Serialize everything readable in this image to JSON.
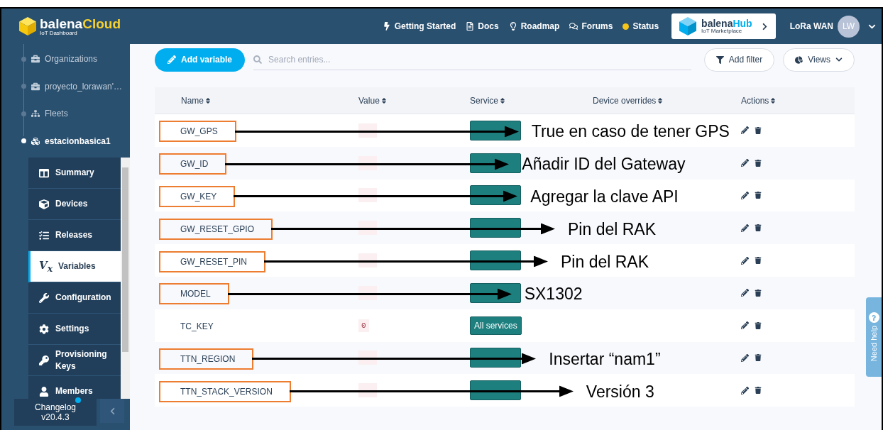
{
  "brand": {
    "name": "balena",
    "product": "Cloud",
    "subtitle": "IoT Dashboard"
  },
  "top_links": [
    {
      "label": "Getting Started"
    },
    {
      "label": "Docs"
    },
    {
      "label": "Roadmap"
    },
    {
      "label": "Forums"
    },
    {
      "label": "Status",
      "color": "#f5c518"
    }
  ],
  "hub": {
    "name": "balena",
    "product": "Hub",
    "subtitle": "IoT Marketplace"
  },
  "user": {
    "name": "LoRa WAN",
    "initials": "LW"
  },
  "breadcrumbs": [
    {
      "label": "Organizations",
      "selected": false
    },
    {
      "label": "proyecto_lorawan'…",
      "selected": false
    },
    {
      "label": "Fleets",
      "selected": false
    },
    {
      "label": "estacionbasica1",
      "selected": true
    }
  ],
  "nav": [
    {
      "label": "Summary",
      "selected": false
    },
    {
      "label": "Devices",
      "selected": false
    },
    {
      "label": "Releases",
      "selected": false
    },
    {
      "label": "Variables",
      "selected": true,
      "glyph": "V$_{x}$"
    },
    {
      "label": "Configuration",
      "selected": false
    },
    {
      "label": "Settings",
      "selected": false
    },
    {
      "label": "Provisioning Keys",
      "selected": false
    },
    {
      "label": "Members",
      "selected": false
    }
  ],
  "changelog": {
    "label": "Changelog",
    "version": "v20.4.3"
  },
  "toolbar": {
    "add_button": "Add variable",
    "search": {
      "placeholder": "Search entries..."
    },
    "filter_button": "Add filter",
    "views_button": "Views"
  },
  "table": {
    "columns": [
      "Name",
      "Value",
      "Service",
      "Device overrides",
      "Actions"
    ],
    "rows": [
      {
        "name": "GW_GPS",
        "highlighted": true,
        "note": "True en caso de tener GPS"
      },
      {
        "name": "GW_ID",
        "highlighted": true,
        "note": "Añadir ID del Gateway"
      },
      {
        "name": "GW_KEY",
        "highlighted": true,
        "note": "Agregar la clave API"
      },
      {
        "name": "GW_RESET_GPIO",
        "highlighted": true,
        "note": "Pin del RAK"
      },
      {
        "name": "GW_RESET_PIN",
        "highlighted": true,
        "note": "Pin del RAK"
      },
      {
        "name": "MODEL",
        "highlighted": true,
        "note": "SX1302"
      },
      {
        "name": "TC_KEY",
        "value": "0",
        "service": "All services",
        "highlighted": false
      },
      {
        "name": "TTN_REGION",
        "highlighted": true,
        "note": "Insertar “nam1”"
      },
      {
        "name": "TTN_STACK_VERSION",
        "highlighted": true,
        "note": "Versión 3"
      }
    ]
  },
  "help_tab": {
    "label": "Need help"
  }
}
